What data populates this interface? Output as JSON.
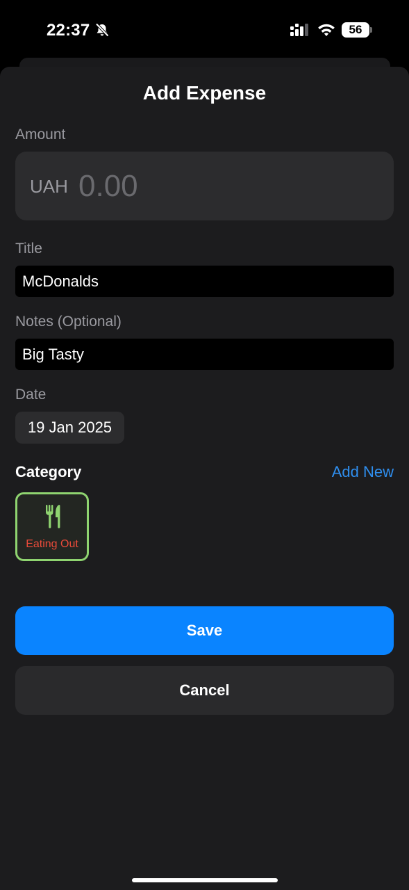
{
  "status_bar": {
    "time": "22:37",
    "battery_level": "56",
    "icons": [
      "bell-slash-icon",
      "cellular-signal-icon",
      "wifi-icon",
      "battery-icon"
    ]
  },
  "sheet": {
    "title": "Add Expense"
  },
  "amount": {
    "label": "Amount",
    "currency": "UAH",
    "value": "",
    "placeholder": "0.00"
  },
  "title_field": {
    "label": "Title",
    "value": "McDonalds"
  },
  "notes_field": {
    "label": "Notes (Optional)",
    "value": "Big Tasty"
  },
  "date_field": {
    "label": "Date",
    "value": "19 Jan 2025"
  },
  "category": {
    "heading": "Category",
    "add_new_label": "Add New",
    "items": [
      {
        "label": "Eating Out",
        "icon": "fork-knife-icon",
        "selected": true,
        "icon_color": "#8fd470",
        "label_color": "#ec4b3a"
      }
    ]
  },
  "actions": {
    "save_label": "Save",
    "cancel_label": "Cancel"
  },
  "colors": {
    "accent": "#0a84ff",
    "link": "#2f8ff0",
    "sheet_background": "#1c1c1e",
    "field_background": "#2c2c2e"
  }
}
